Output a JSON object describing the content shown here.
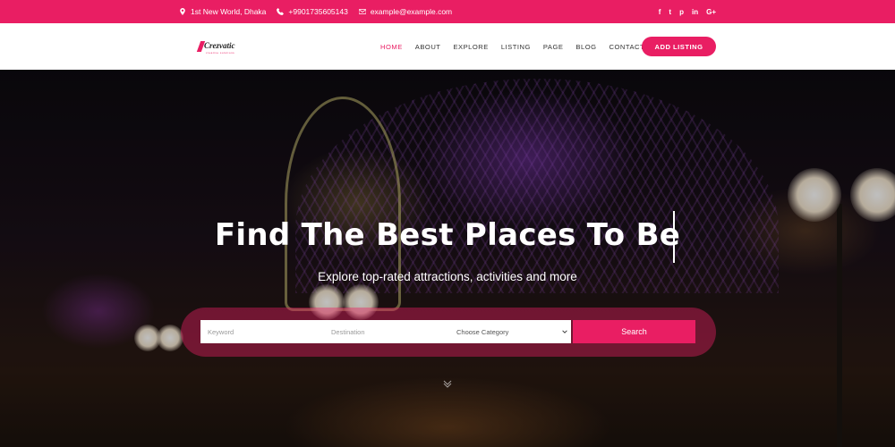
{
  "topbar": {
    "address": "1st New World, Dhaka",
    "phone": "+9901735605143",
    "email": "example@example.com",
    "social": [
      "f",
      "t",
      "p",
      "in",
      "G+"
    ]
  },
  "brand": {
    "name": "Crezvatic",
    "tagline": "creative solutions"
  },
  "nav": {
    "items": [
      {
        "label": "HOME",
        "active": true
      },
      {
        "label": "ABOUT"
      },
      {
        "label": "EXPLORE"
      },
      {
        "label": "LISTING"
      },
      {
        "label": "PAGE"
      },
      {
        "label": "BLOG"
      },
      {
        "label": "CONTACT"
      }
    ],
    "cta": "ADD LISTING"
  },
  "hero": {
    "title": "Find The Best Places To Be",
    "subtitle": "Explore top-rated attractions, activities and more"
  },
  "search": {
    "keyword_placeholder": "Keyword",
    "destination_placeholder": "Destination",
    "category_selected": "Choose Category",
    "button": "Search"
  },
  "colors": {
    "accent": "#e91e63"
  }
}
